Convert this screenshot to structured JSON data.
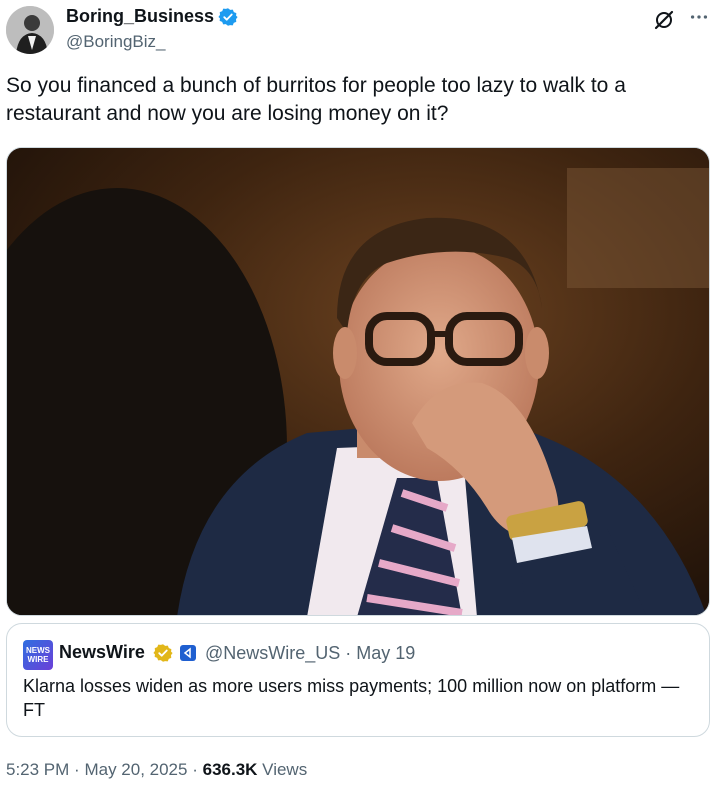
{
  "author": {
    "name": "Boring_Business",
    "handle": "@BoringBiz_",
    "verified_color": "#1d9bf0"
  },
  "icons": {
    "grok": "grok-icon",
    "more": "more-options-icon"
  },
  "tweet": {
    "text": "So you financed a bunch of burritos for people too lazy to walk to a restaurant and now you are losing money on it?"
  },
  "quoted": {
    "logo_text": "NEWS WIRE",
    "name": "NewsWire",
    "meta": "@NewsWire_US · May 19",
    "text": "Klarna losses widen as more users miss payments; 100 million now on platform — FT",
    "badge_color": "#e2b719"
  },
  "footer": {
    "time": "5:23 PM",
    "date": "May 20, 2025",
    "views_count": "636.3K",
    "views_label": "Views",
    "sep": "·"
  }
}
